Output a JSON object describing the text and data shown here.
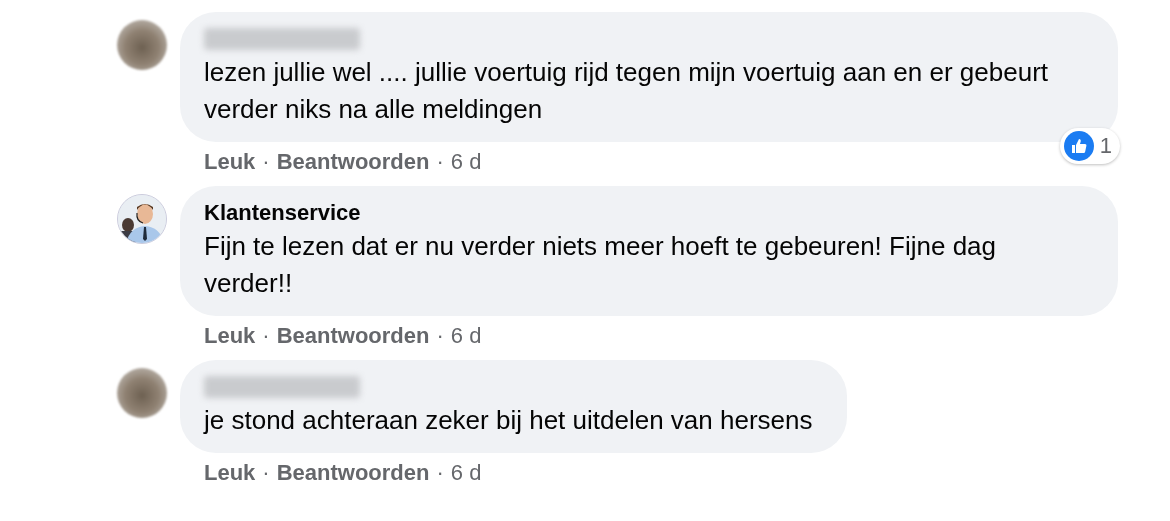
{
  "comments": [
    {
      "avatar": {
        "kind": "blurred"
      },
      "author": {
        "kind": "blurred"
      },
      "text": "lezen jullie wel .... jullie voertuig rijd tegen mijn voertuig aan en er gebeurt verder niks na alle meldingen",
      "reactions": {
        "count": "1"
      },
      "actions": {
        "like": "Leuk",
        "separator_1": "·",
        "reply": "Beantwoorden",
        "separator_2": "·",
        "time": "6 d"
      }
    },
    {
      "author": {
        "kind": "named",
        "name": "Klantenservice"
      },
      "text": "Fijn te lezen dat er nu verder niets meer hoeft te gebeuren! Fijne dag verder!!",
      "actions": {
        "like": "Leuk",
        "separator_1": "·",
        "reply": "Beantwoorden",
        "separator_2": "·",
        "time": "6 d"
      }
    },
    {
      "avatar": {
        "kind": "blurred"
      },
      "author": {
        "kind": "blurred"
      },
      "text": "je stond achteraan zeker bij het uitdelen van hersens",
      "actions": {
        "like": "Leuk",
        "separator_1": "·",
        "reply": "Beantwoorden",
        "separator_2": "·",
        "time": "6 d"
      }
    }
  ]
}
